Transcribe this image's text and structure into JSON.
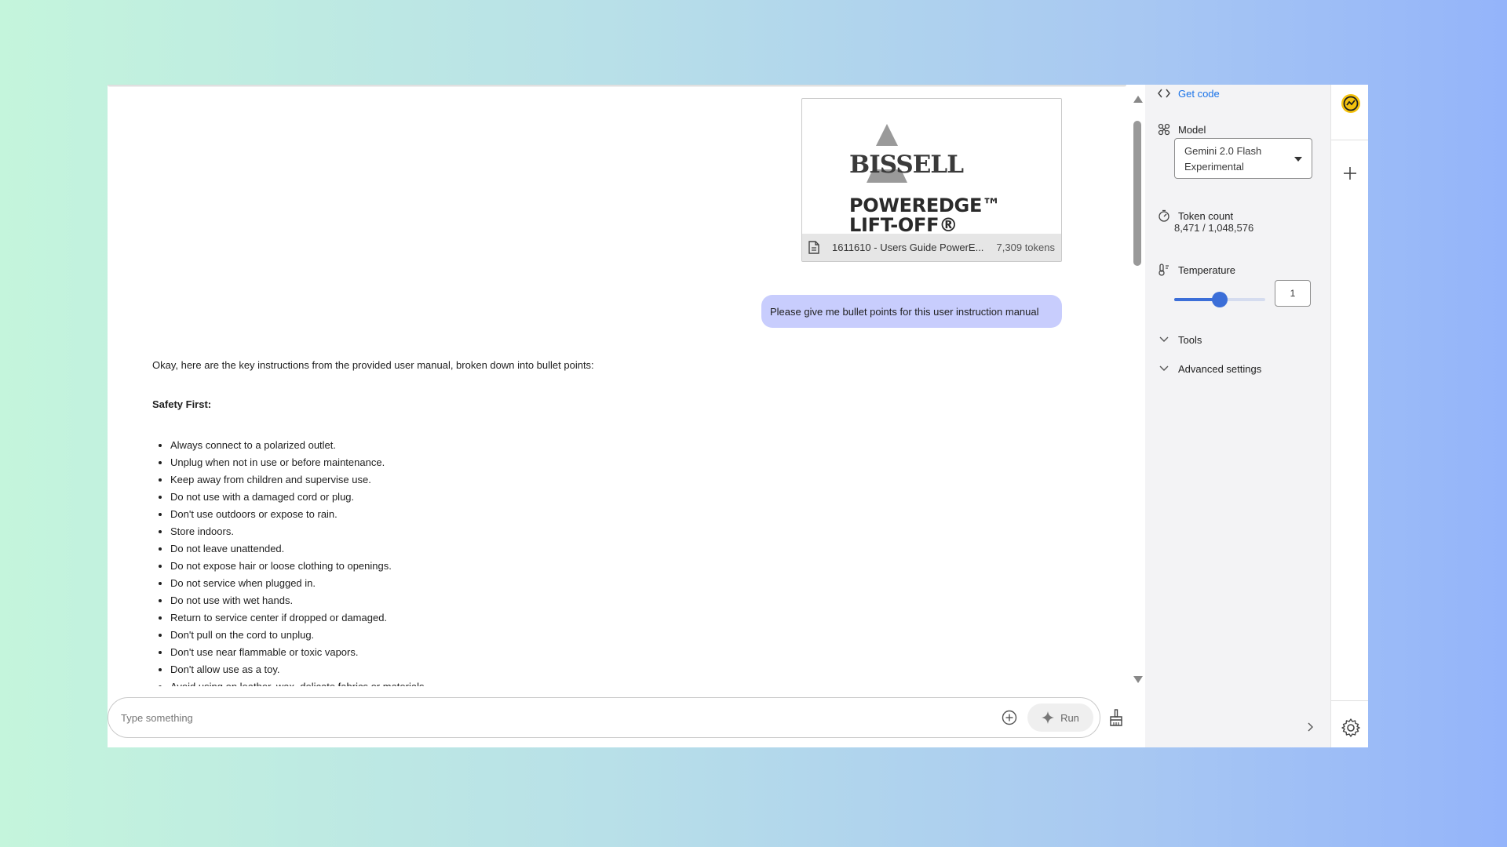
{
  "attachment": {
    "brand": "BISSELL",
    "product_line1": "POWEREDGE™",
    "product_line2": "LIFT-OFF®",
    "file_name": "1611610 - Users Guide PowerE...",
    "tokens": "7,309 tokens"
  },
  "user_message": "Please give me bullet points for this user instruction manual",
  "response": {
    "intro": "Okay, here are the key instructions from the provided user manual, broken down into bullet points:",
    "section_title": "Safety First:",
    "bullets": [
      "Always connect to a polarized outlet.",
      "Unplug when not in use or before maintenance.",
      "Keep away from children and supervise use.",
      "Do not use with a damaged cord or plug.",
      "Don't use outdoors or expose to rain.",
      "Store indoors.",
      "Do not leave unattended.",
      "Do not expose hair or loose clothing to openings.",
      "Do not service when plugged in.",
      "Do not use with wet hands.",
      "Return to service center if dropped or damaged.",
      "Don't pull on the cord to unplug.",
      "Don't use near flammable or toxic vapors.",
      "Don't allow use as a toy.",
      "Avoid using on leather, wax, delicate fabrics or materials."
    ]
  },
  "input": {
    "placeholder": "Type something",
    "run_label": "Run"
  },
  "settings": {
    "get_code": "Get code",
    "model_label": "Model",
    "model_line1": "Gemini 2.0 Flash",
    "model_line2": "Experimental",
    "token_count_label": "Token count",
    "token_count_value": "8,471 / 1,048,576",
    "temperature_label": "Temperature",
    "temperature_value": "1",
    "temperature_fraction": 0.5,
    "tools_label": "Tools",
    "advanced_label": "Advanced settings"
  },
  "colors": {
    "accent": "#3b6ed8",
    "user_bubble": "#c8cdfd",
    "link": "#1a73e8",
    "brand_icon": "#f4c20d"
  }
}
